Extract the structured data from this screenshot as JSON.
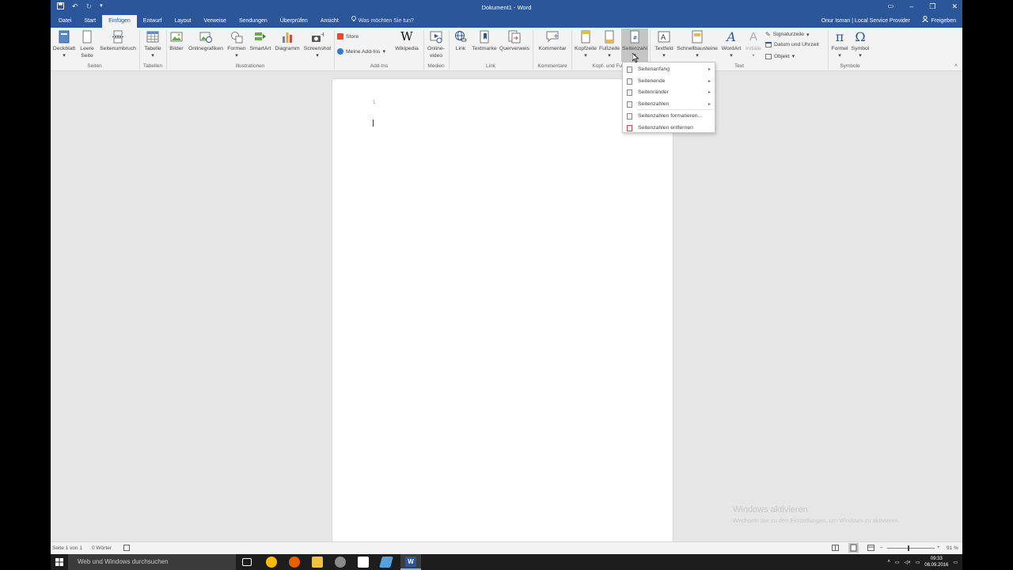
{
  "titlebar": {
    "title": "Dokument1 - Word",
    "save_icon": "save-icon",
    "undo_icon": "undo-icon",
    "redo_icon": "redo-icon",
    "customize_icon": "customize-qat-icon",
    "ribbon_display_icon": "ribbon-display-icon",
    "minimize": "–",
    "restore": "❐",
    "close": "✕"
  },
  "tabs": [
    "Datei",
    "Start",
    "Einfügen",
    "Entwurf",
    "Layout",
    "Verweise",
    "Sendungen",
    "Überprüfen",
    "Ansicht"
  ],
  "active_tab": "Einfügen",
  "tell_me": "Was möchten Sie tun?",
  "user": "Onur Isman | Local Service Provider",
  "share": "Freigeben",
  "ribbon": {
    "buttons": {
      "deckblatt": "Deckblatt",
      "leere_seite_1": "Leere",
      "leere_seite_2": "Seite",
      "seitenumbruch": "Seitenumbruch",
      "tabelle": "Tabelle",
      "bilder": "Bilder",
      "onlinegrafiken": "Onlinegrafiken",
      "formen": "Formen",
      "smartart": "SmartArt",
      "diagramm": "Diagramm",
      "screenshot": "Screenshot",
      "store": "Store",
      "meine_addins": "Meine Add-Ins",
      "wikipedia": "Wikipedia",
      "onlinevideo_1": "Online-",
      "onlinevideo_2": "video",
      "link": "Link",
      "textmarke": "Textmarke",
      "querverweis": "Querverweis",
      "kommentar": "Kommentar",
      "kopfzeile": "Kopfzeile",
      "fusszeile": "Fußzeile",
      "seitenzahl": "Seitenzahl",
      "textfeld": "Textfeld",
      "schnellbausteine": "Schnellbausteine",
      "wordart": "WordArt",
      "initiale": "Initiale",
      "signaturzeile": "Signaturzeile",
      "datum_uhrzeit": "Datum und Uhrzeit",
      "objekt": "Objekt",
      "formel": "Formel",
      "symbol": "Symbol"
    },
    "groups": {
      "seiten": "Seiten",
      "tabellen": "Tabellen",
      "illustrationen": "Illustrationen",
      "addins": "Add-Ins",
      "medien": "Medien",
      "link": "Link",
      "kommentare": "Kommentare",
      "kopf_fuss": "Kopf- und Fu",
      "text": "Text",
      "symbole": "Symbole"
    }
  },
  "menu": {
    "items": [
      {
        "label": "Seitenanfang",
        "submenu": true
      },
      {
        "label": "Seitenende",
        "submenu": true
      },
      {
        "label": "Seitenränder",
        "submenu": true
      },
      {
        "label": "Seitenzahlen",
        "submenu": true
      },
      {
        "label": "Seitenzahlen formatieren...",
        "submenu": false
      },
      {
        "label": "Seitenzahlen entfernen",
        "submenu": false
      }
    ]
  },
  "document": {
    "header_page_number": "1"
  },
  "status": {
    "page": "Seite 1 von 1",
    "words": "0 Wörter",
    "zoom": "91 %",
    "zoom_minus": "–",
    "zoom_plus": "+",
    "zoom_level": 0.45
  },
  "watermark": {
    "line1": "Windows aktivieren",
    "line2": "Wechseln Sie zu den Einstellungen, um Windows zu aktivieren."
  },
  "taskbar": {
    "search": "Web und Windows durchsuchen",
    "time": "09:33",
    "date": "08.09.2016"
  },
  "colors": {
    "accent": "#2b579a",
    "ribbon": "#f3f3f3",
    "canvas": "#e6e6e6"
  }
}
